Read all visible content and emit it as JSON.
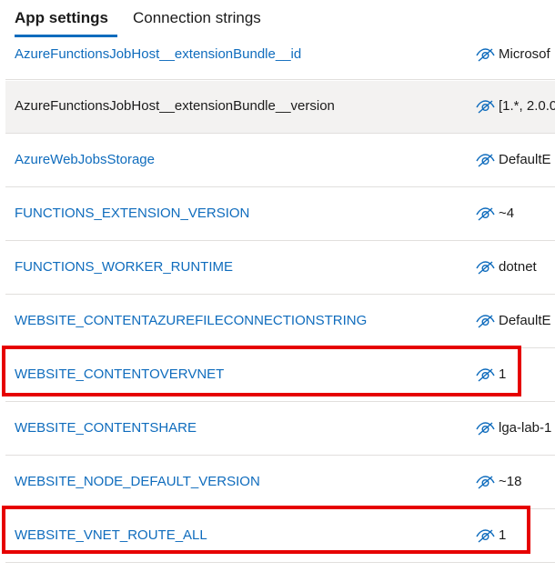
{
  "tabs": [
    {
      "label": "App settings",
      "active": true
    },
    {
      "label": "Connection strings",
      "active": false
    }
  ],
  "settings": [
    {
      "name": "AzureFunctionsJobHost__extensionBundle__id",
      "value": "Microsof"
    },
    {
      "name": "AzureFunctionsJobHost__extensionBundle__version",
      "value": "[1.*, 2.0.0",
      "hover": true
    },
    {
      "name": "AzureWebJobsStorage",
      "value": "DefaultE"
    },
    {
      "name": "FUNCTIONS_EXTENSION_VERSION",
      "value": "~4"
    },
    {
      "name": "FUNCTIONS_WORKER_RUNTIME",
      "value": "dotnet"
    },
    {
      "name": "WEBSITE_CONTENTAZUREFILECONNECTIONSTRING",
      "value": "DefaultE"
    },
    {
      "name": "WEBSITE_CONTENTOVERVNET",
      "value": "1",
      "highlighted": true
    },
    {
      "name": "WEBSITE_CONTENTSHARE",
      "value": "lga-lab-1"
    },
    {
      "name": "WEBSITE_NODE_DEFAULT_VERSION",
      "value": "~18"
    },
    {
      "name": "WEBSITE_VNET_ROUTE_ALL",
      "value": "1",
      "highlighted": true
    }
  ],
  "icons": {
    "value_visibility": "hidden-value-eye-icon"
  },
  "colors": {
    "link": "#0f6cbd",
    "highlight": "#e60000",
    "hover_row": "#f3f2f1",
    "tab_underline": "#0f6cbd"
  }
}
